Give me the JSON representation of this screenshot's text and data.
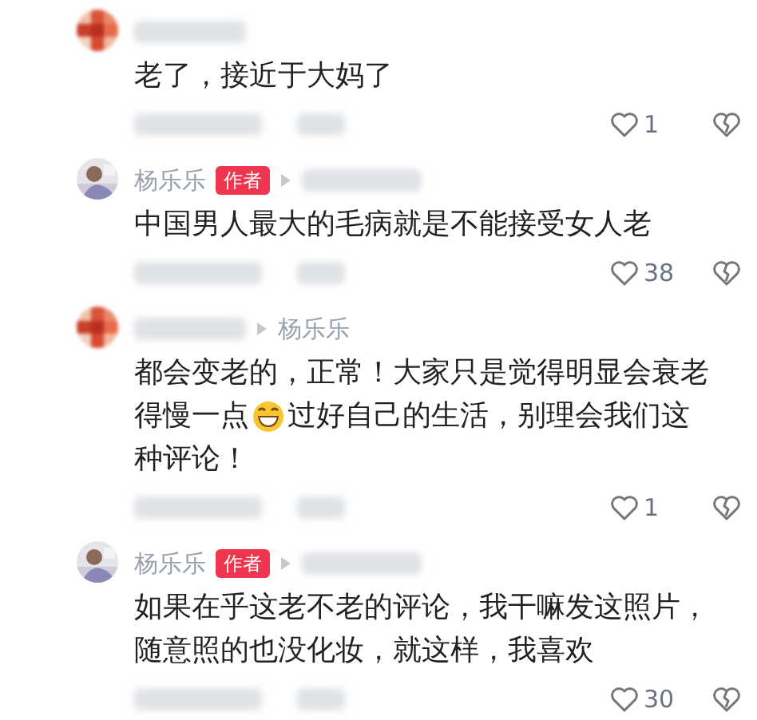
{
  "comments": [
    {
      "avatar": {
        "kind": "pixelated"
      },
      "author": {
        "kind": "redacted"
      },
      "lines": [
        [
          {
            "kind": "text",
            "text": "老了，接近于大妈了"
          }
        ]
      ],
      "likes": "1"
    },
    {
      "avatar": {
        "kind": "picture"
      },
      "author": {
        "kind": "named",
        "name": "杨乐乐",
        "badge": "作者"
      },
      "reply_to": {
        "kind": "redacted"
      },
      "lines": [
        [
          {
            "kind": "text",
            "text": "中国男人最大的毛病就是不能接受女人老"
          }
        ]
      ],
      "likes": "38"
    },
    {
      "avatar": {
        "kind": "pixelated"
      },
      "author": {
        "kind": "redacted"
      },
      "reply_to": {
        "kind": "named",
        "name": "杨乐乐"
      },
      "lines": [
        [
          {
            "kind": "text",
            "text": "都会变老的，正常！大家只是觉得明显会衰老"
          }
        ],
        [
          {
            "kind": "text",
            "text": "得慢一点"
          },
          {
            "kind": "emoji"
          },
          {
            "kind": "text",
            "text": "过好自己的生活，别理会我们这"
          }
        ],
        [
          {
            "kind": "text",
            "text": "种评论！"
          }
        ]
      ],
      "likes": "1"
    },
    {
      "avatar": {
        "kind": "picture"
      },
      "author": {
        "kind": "named",
        "name": "杨乐乐",
        "badge": "作者"
      },
      "reply_to": {
        "kind": "redacted"
      },
      "lines": [
        [
          {
            "kind": "text",
            "text": "如果在乎这老不老的评论，我干嘛发这照片，"
          }
        ],
        [
          {
            "kind": "text",
            "text": "随意照的也没化妆，就这样，我喜欢"
          }
        ]
      ],
      "likes": "30"
    }
  ]
}
